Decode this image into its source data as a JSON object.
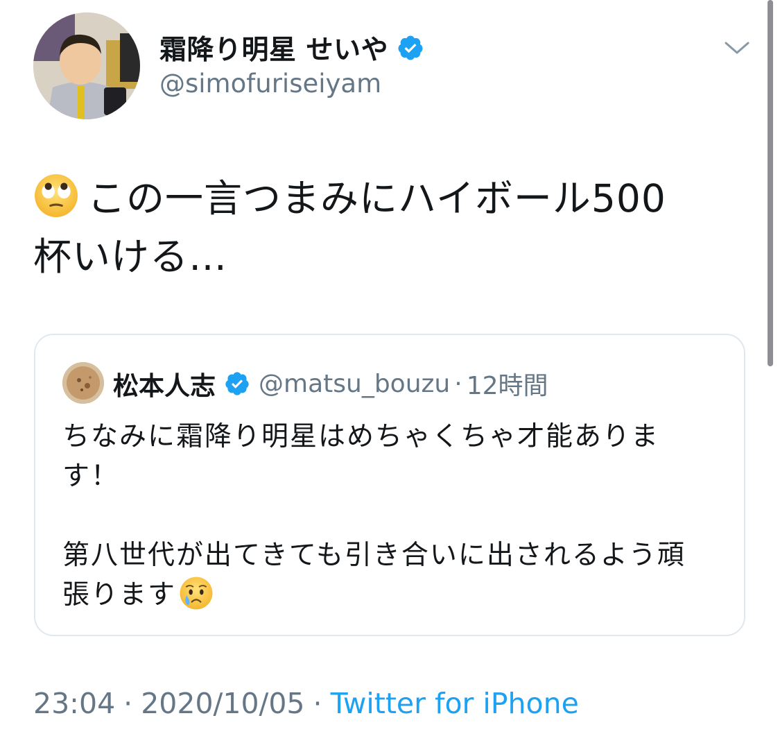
{
  "tweet": {
    "author": {
      "display_name": "霜降り明星 せいや",
      "handle": "@simofuriseiyam",
      "verified": true
    },
    "text_emoji": "face-with-rolling-eyes",
    "text": "この一言つまみにハイボール500\n杯いける…",
    "timestamp": {
      "time": "23:04",
      "separator": "·",
      "date": "2020/10/05",
      "source": "Twitter for iPhone"
    }
  },
  "quoted_tweet": {
    "author": {
      "display_name": "松本人志",
      "handle": "@matsu_bouzu",
      "verified": true
    },
    "separator": "·",
    "relative_time": "12時間",
    "text": "ちなみに霜降り明星はめちゃくちゃ才能ありま\nす！\n\n第八世代が出てきても引き合いに出されるよう頑\n張ります",
    "trailing_emoji": "crying-face"
  },
  "colors": {
    "verified_blue": "#1da1f2",
    "secondary_text": "#657786",
    "link": "#1da1f2",
    "border": "#e1e8ed"
  }
}
